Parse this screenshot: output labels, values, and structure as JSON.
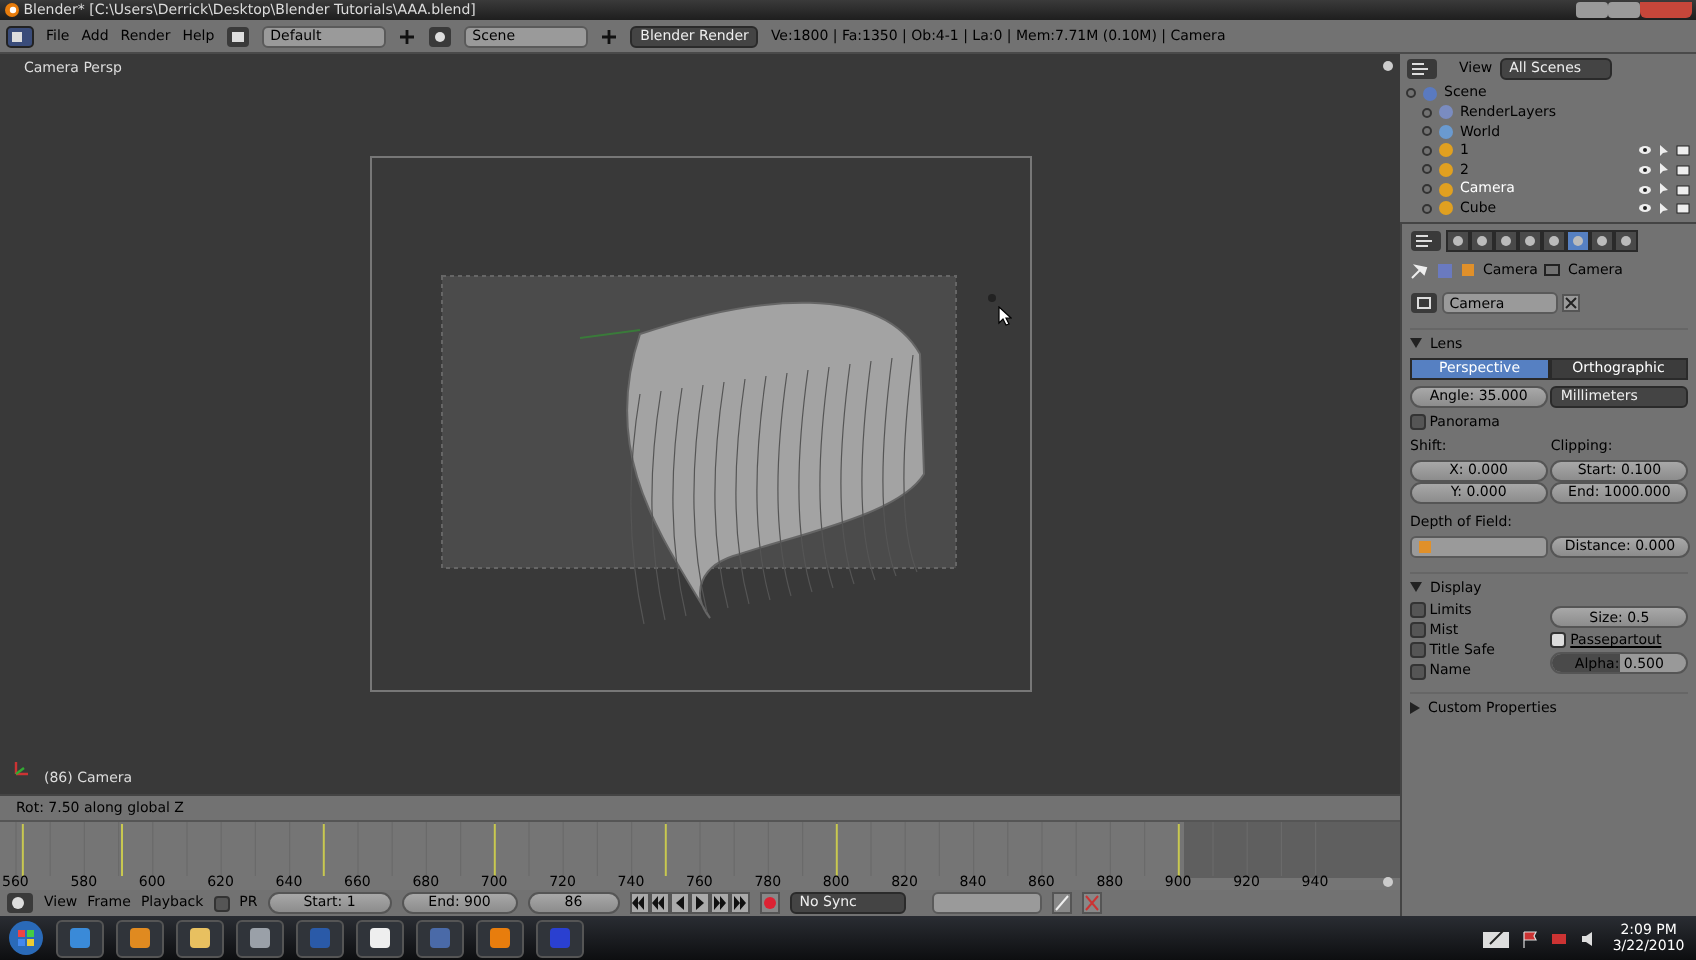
{
  "window": {
    "title": "Blender* [C:\\Users\\Derrick\\Desktop\\Blender Tutorials\\AAA.blend]"
  },
  "header": {
    "menus": [
      "File",
      "Add",
      "Render",
      "Help"
    ],
    "layout": "Default",
    "scene": "Scene",
    "engine": "Blender Render",
    "stats": "Ve:1800 | Fa:1350 | Ob:4-1 | La:0 | Mem:7.71M (0.10M) | Camera"
  },
  "viewport": {
    "view_label": "Camera Persp",
    "object_label": "(86) Camera",
    "status": "Rot: 7.50 along global Z"
  },
  "outliner": {
    "view_menu": "View",
    "filter": "All Scenes",
    "tree": [
      {
        "name": "Scene",
        "kind": "scene",
        "selected": false,
        "children": [
          {
            "name": "RenderLayers",
            "kind": "layers",
            "selected": false
          },
          {
            "name": "World",
            "kind": "world",
            "selected": false
          },
          {
            "name": "1",
            "kind": "object",
            "selected": false
          },
          {
            "name": "2",
            "kind": "object",
            "selected": false
          },
          {
            "name": "Camera",
            "kind": "object",
            "selected": true
          },
          {
            "name": "Cube",
            "kind": "object",
            "selected": false
          }
        ]
      }
    ]
  },
  "properties": {
    "breadcrumb": [
      "Camera",
      "Camera"
    ],
    "datablock": "Camera",
    "lens": {
      "title": "Lens",
      "tabs": [
        {
          "label": "Perspective",
          "selected": true
        },
        {
          "label": "Orthographic",
          "selected": false
        }
      ],
      "angle": "Angle: 35.000",
      "unit": "Millimeters",
      "panorama": {
        "label": "Panorama",
        "checked": false
      },
      "shift_label": "Shift:",
      "shift_x": "X: 0.000",
      "shift_y": "Y: 0.000",
      "clipping_label": "Clipping:",
      "clip_start": "Start: 0.100",
      "clip_end": "End: 1000.000",
      "dof_label": "Depth of Field:",
      "dof_distance": "Distance: 0.000"
    },
    "display": {
      "title": "Display",
      "checks": [
        {
          "label": "Limits",
          "checked": false
        },
        {
          "label": "Mist",
          "checked": false
        },
        {
          "label": "Title Safe",
          "checked": false
        },
        {
          "label": "Name",
          "checked": false
        }
      ],
      "size": "Size: 0.5",
      "passepartout": {
        "label": "Passepartout",
        "checked": true
      },
      "alpha": {
        "text": "Alpha: 0.500",
        "level": 0.5
      }
    },
    "custom_properties": {
      "title": "Custom Properties",
      "expanded": false
    }
  },
  "timeline": {
    "ticks": [
      "560",
      "580",
      "600",
      "620",
      "640",
      "660",
      "680",
      "700",
      "720",
      "740",
      "760",
      "780",
      "800",
      "820",
      "840",
      "860",
      "880",
      "900",
      "920",
      "940"
    ],
    "menus": [
      "View",
      "Frame",
      "Playback"
    ],
    "preview_range": {
      "label": "PR",
      "checked": false
    },
    "start": "Start: 1",
    "end": "End: 900",
    "current": "86",
    "sync": "No Sync"
  },
  "taskbar": {
    "time": "2:09 PM",
    "date": "3/22/2010"
  }
}
